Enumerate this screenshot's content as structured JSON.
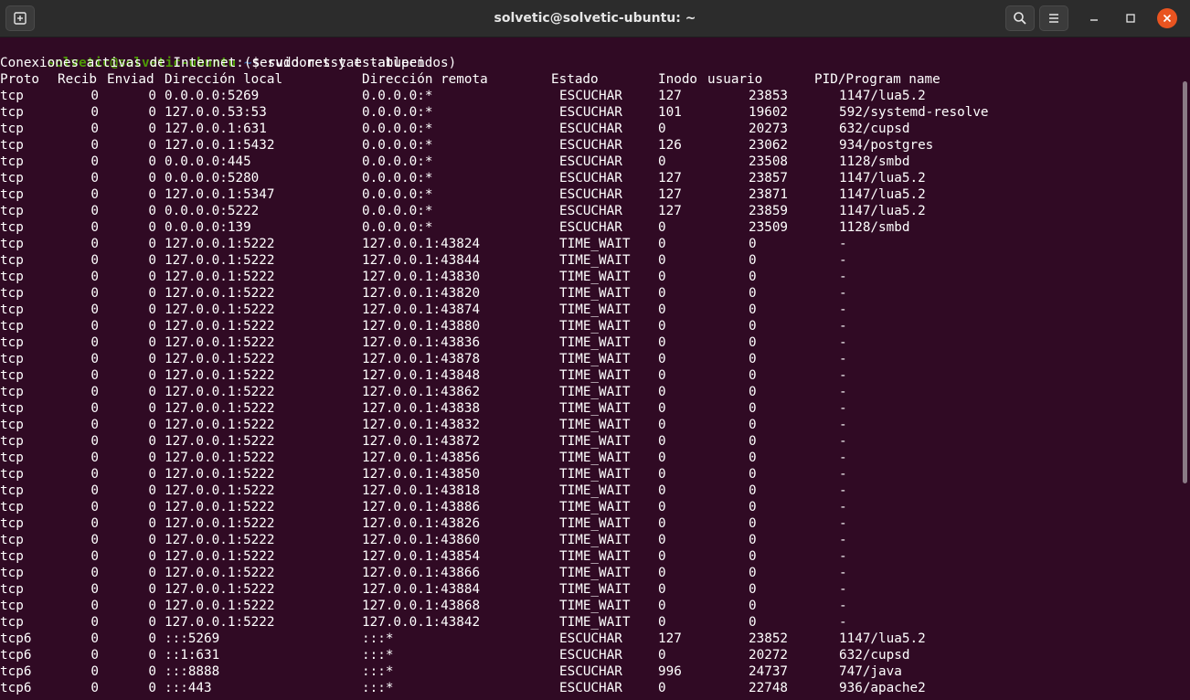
{
  "window": {
    "title": "solvetic@solvetic-ubuntu: ~",
    "icons": {
      "new_tab": "new-tab-icon",
      "search": "search-icon",
      "menu": "hamburger-menu-icon",
      "minimize": "minimize-icon",
      "maximize": "maximize-icon",
      "close": "close-icon"
    },
    "colors": {
      "background": "#300a24",
      "titlebar": "#2c2c2c",
      "prompt_user": "#4e9a06",
      "prompt_path": "#3465a4",
      "close_button": "#e95420"
    }
  },
  "terminal": {
    "prompt": {
      "user_host": "solvetic@solvetic-ubuntu",
      "colon": ":",
      "path": "~",
      "symbol": "$",
      "command": " sudo netstat -atupen"
    },
    "intro": "Conexiones activas de Internet (servidores y establecidos)",
    "headers": [
      "Proto",
      "Recib",
      "Enviad",
      "Dirección local",
      "Dirección remota",
      "Estado",
      "Inodo",
      "usuario",
      "PID/Program name"
    ],
    "rows": [
      [
        "tcp",
        "0",
        "0",
        "0.0.0.0:5269",
        "0.0.0.0:*",
        "ESCUCHAR",
        "127",
        "23853",
        "1147/lua5.2"
      ],
      [
        "tcp",
        "0",
        "0",
        "127.0.0.53:53",
        "0.0.0.0:*",
        "ESCUCHAR",
        "101",
        "19602",
        "592/systemd-resolve"
      ],
      [
        "tcp",
        "0",
        "0",
        "127.0.0.1:631",
        "0.0.0.0:*",
        "ESCUCHAR",
        "0",
        "20273",
        "632/cupsd"
      ],
      [
        "tcp",
        "0",
        "0",
        "127.0.0.1:5432",
        "0.0.0.0:*",
        "ESCUCHAR",
        "126",
        "23062",
        "934/postgres"
      ],
      [
        "tcp",
        "0",
        "0",
        "0.0.0.0:445",
        "0.0.0.0:*",
        "ESCUCHAR",
        "0",
        "23508",
        "1128/smbd"
      ],
      [
        "tcp",
        "0",
        "0",
        "0.0.0.0:5280",
        "0.0.0.0:*",
        "ESCUCHAR",
        "127",
        "23857",
        "1147/lua5.2"
      ],
      [
        "tcp",
        "0",
        "0",
        "127.0.0.1:5347",
        "0.0.0.0:*",
        "ESCUCHAR",
        "127",
        "23871",
        "1147/lua5.2"
      ],
      [
        "tcp",
        "0",
        "0",
        "0.0.0.0:5222",
        "0.0.0.0:*",
        "ESCUCHAR",
        "127",
        "23859",
        "1147/lua5.2"
      ],
      [
        "tcp",
        "0",
        "0",
        "0.0.0.0:139",
        "0.0.0.0:*",
        "ESCUCHAR",
        "0",
        "23509",
        "1128/smbd"
      ],
      [
        "tcp",
        "0",
        "0",
        "127.0.0.1:5222",
        "127.0.0.1:43824",
        "TIME_WAIT",
        "0",
        "0",
        "-"
      ],
      [
        "tcp",
        "0",
        "0",
        "127.0.0.1:5222",
        "127.0.0.1:43844",
        "TIME_WAIT",
        "0",
        "0",
        "-"
      ],
      [
        "tcp",
        "0",
        "0",
        "127.0.0.1:5222",
        "127.0.0.1:43830",
        "TIME_WAIT",
        "0",
        "0",
        "-"
      ],
      [
        "tcp",
        "0",
        "0",
        "127.0.0.1:5222",
        "127.0.0.1:43820",
        "TIME_WAIT",
        "0",
        "0",
        "-"
      ],
      [
        "tcp",
        "0",
        "0",
        "127.0.0.1:5222",
        "127.0.0.1:43874",
        "TIME_WAIT",
        "0",
        "0",
        "-"
      ],
      [
        "tcp",
        "0",
        "0",
        "127.0.0.1:5222",
        "127.0.0.1:43880",
        "TIME_WAIT",
        "0",
        "0",
        "-"
      ],
      [
        "tcp",
        "0",
        "0",
        "127.0.0.1:5222",
        "127.0.0.1:43836",
        "TIME_WAIT",
        "0",
        "0",
        "-"
      ],
      [
        "tcp",
        "0",
        "0",
        "127.0.0.1:5222",
        "127.0.0.1:43878",
        "TIME_WAIT",
        "0",
        "0",
        "-"
      ],
      [
        "tcp",
        "0",
        "0",
        "127.0.0.1:5222",
        "127.0.0.1:43848",
        "TIME_WAIT",
        "0",
        "0",
        "-"
      ],
      [
        "tcp",
        "0",
        "0",
        "127.0.0.1:5222",
        "127.0.0.1:43862",
        "TIME_WAIT",
        "0",
        "0",
        "-"
      ],
      [
        "tcp",
        "0",
        "0",
        "127.0.0.1:5222",
        "127.0.0.1:43838",
        "TIME_WAIT",
        "0",
        "0",
        "-"
      ],
      [
        "tcp",
        "0",
        "0",
        "127.0.0.1:5222",
        "127.0.0.1:43832",
        "TIME_WAIT",
        "0",
        "0",
        "-"
      ],
      [
        "tcp",
        "0",
        "0",
        "127.0.0.1:5222",
        "127.0.0.1:43872",
        "TIME_WAIT",
        "0",
        "0",
        "-"
      ],
      [
        "tcp",
        "0",
        "0",
        "127.0.0.1:5222",
        "127.0.0.1:43856",
        "TIME_WAIT",
        "0",
        "0",
        "-"
      ],
      [
        "tcp",
        "0",
        "0",
        "127.0.0.1:5222",
        "127.0.0.1:43850",
        "TIME_WAIT",
        "0",
        "0",
        "-"
      ],
      [
        "tcp",
        "0",
        "0",
        "127.0.0.1:5222",
        "127.0.0.1:43818",
        "TIME_WAIT",
        "0",
        "0",
        "-"
      ],
      [
        "tcp",
        "0",
        "0",
        "127.0.0.1:5222",
        "127.0.0.1:43886",
        "TIME_WAIT",
        "0",
        "0",
        "-"
      ],
      [
        "tcp",
        "0",
        "0",
        "127.0.0.1:5222",
        "127.0.0.1:43826",
        "TIME_WAIT",
        "0",
        "0",
        "-"
      ],
      [
        "tcp",
        "0",
        "0",
        "127.0.0.1:5222",
        "127.0.0.1:43860",
        "TIME_WAIT",
        "0",
        "0",
        "-"
      ],
      [
        "tcp",
        "0",
        "0",
        "127.0.0.1:5222",
        "127.0.0.1:43854",
        "TIME_WAIT",
        "0",
        "0",
        "-"
      ],
      [
        "tcp",
        "0",
        "0",
        "127.0.0.1:5222",
        "127.0.0.1:43866",
        "TIME_WAIT",
        "0",
        "0",
        "-"
      ],
      [
        "tcp",
        "0",
        "0",
        "127.0.0.1:5222",
        "127.0.0.1:43884",
        "TIME_WAIT",
        "0",
        "0",
        "-"
      ],
      [
        "tcp",
        "0",
        "0",
        "127.0.0.1:5222",
        "127.0.0.1:43868",
        "TIME_WAIT",
        "0",
        "0",
        "-"
      ],
      [
        "tcp",
        "0",
        "0",
        "127.0.0.1:5222",
        "127.0.0.1:43842",
        "TIME_WAIT",
        "0",
        "0",
        "-"
      ],
      [
        "tcp6",
        "0",
        "0",
        ":::5269",
        ":::*",
        "ESCUCHAR",
        "127",
        "23852",
        "1147/lua5.2"
      ],
      [
        "tcp6",
        "0",
        "0",
        "::1:631",
        ":::*",
        "ESCUCHAR",
        "0",
        "20272",
        "632/cupsd"
      ],
      [
        "tcp6",
        "0",
        "0",
        ":::8888",
        ":::*",
        "ESCUCHAR",
        "996",
        "24737",
        "747/java"
      ],
      [
        "tcp6",
        "0",
        "0",
        ":::443",
        ":::*",
        "ESCUCHAR",
        "0",
        "22748",
        "936/apache2"
      ]
    ]
  }
}
